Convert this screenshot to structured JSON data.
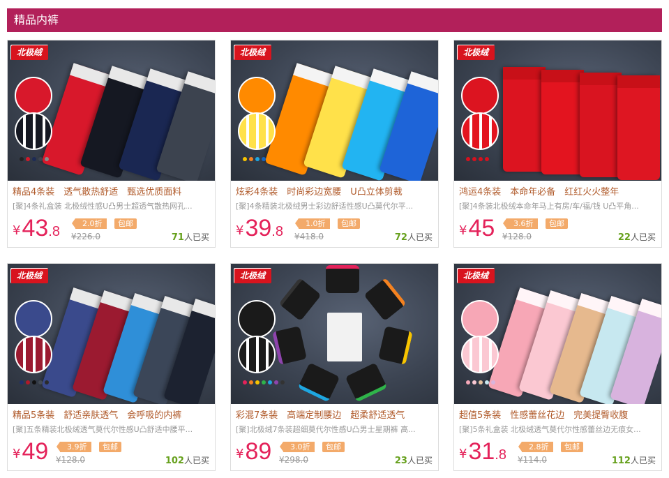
{
  "section": {
    "title": "精品内裤"
  },
  "labels": {
    "yen": "¥",
    "bought_suffix": "人已买",
    "discount_suffix": "折"
  },
  "products": [
    {
      "brand": "北极绒",
      "title": "精品4条装　透气散热舒适　甄选优质面料",
      "desc": "[聚]4条礼盒装 北极绒性感U凸男士超透气散热网孔...",
      "price_int": "43",
      "price_dec": ".8",
      "discount": "2.0",
      "tag": "包邮",
      "original": "¥226.0",
      "sold": "71",
      "swatches": [
        "#222222",
        "#d21a2a",
        "#1d2b55",
        "#3e4450",
        "#8b8b8b"
      ],
      "garments": [
        "#d8182b",
        "#151822",
        "#1a2752",
        "#3c434f"
      ]
    },
    {
      "brand": "北极绒",
      "title": "炫彩4条装　时尚彩边宽腰　U凸立体剪裁",
      "desc": "[聚]4条精装北极绒男士彩边舒适性感U凸莫代尔平...",
      "price_int": "39",
      "price_dec": ".8",
      "discount": "1.0",
      "tag": "包邮",
      "original": "¥418.0",
      "sold": "72",
      "swatches": [
        "#f7c400",
        "#f58220",
        "#1ea7e1",
        "#1565c0"
      ],
      "garments": [
        "#ff8a00",
        "#ffe14a",
        "#22b4f2",
        "#1e64d8"
      ]
    },
    {
      "brand": "北极绒",
      "title": "鸿运4条装　本命年必备　红红火火整年",
      "desc": "[聚]4条装北极绒本命年马上有房/车/福/钱 U凸平角...",
      "price_int": "45",
      "price_dec": "",
      "discount": "3.6",
      "tag": "包邮",
      "original": "¥128.0",
      "sold": "22",
      "swatches": [
        "#d7111e",
        "#d7111e",
        "#d7111e",
        "#d7111e"
      ],
      "garments": [
        "#dc1420",
        "#e3141f",
        "#d91420",
        "#de1622"
      ]
    },
    {
      "brand": "北极绒",
      "title": "精品5条装　舒适亲肤透气　会呼吸的内裤",
      "desc": "[聚]五条精装北极绒透气莫代尔性感U凸舒适中腰平...",
      "price_int": "49",
      "price_dec": "",
      "discount": "3.9",
      "tag": "包邮",
      "original": "¥128.0",
      "sold": "102",
      "swatches": [
        "#1e2f6a",
        "#b01a2a",
        "#111111",
        "#444b55",
        "#2b2b2b"
      ],
      "garments": [
        "#3a4a8c",
        "#9b1a30",
        "#2f8fd8",
        "#3b4658",
        "#1c2230"
      ]
    },
    {
      "brand": "北极绒",
      "title": "彩混7条装　高端定制腰边　超柔舒适透气",
      "desc": "[聚]北极绒7条装超细莫代尔性感U凸男士星期裤 高...",
      "price_int": "89",
      "price_dec": "",
      "discount": "3.0",
      "tag": "包邮",
      "original": "¥298.0",
      "sold": "23",
      "swatches": [
        "#e4225a",
        "#f58220",
        "#f7c400",
        "#2fb34a",
        "#1ea7e1",
        "#8e44ad",
        "#333333"
      ],
      "garments": [
        "#1a1a1a",
        "#1a1a1a",
        "#1a1a1a",
        "#1a1a1a",
        "#1a1a1a",
        "#1a1a1a",
        "#1a1a1a"
      ]
    },
    {
      "brand": "北极绒",
      "title": "超值5条装　性感蕾丝花边　完美提臀收腹",
      "desc": "[聚]5条礼盒装 北极绒透气莫代尔性感蕾丝边无痕女...",
      "price_int": "31",
      "price_dec": ".8",
      "discount": "2.8",
      "tag": "包邮",
      "original": "¥114.0",
      "sold": "112",
      "swatches": [
        "#f5a8b8",
        "#f9c8d2",
        "#e7c3a0",
        "#c8e7ef",
        "#d9b5dc"
      ],
      "garments": [
        "#f7a7b6",
        "#fbc8d2",
        "#e6b98e",
        "#c7e8f0",
        "#d8b3de"
      ]
    }
  ]
}
